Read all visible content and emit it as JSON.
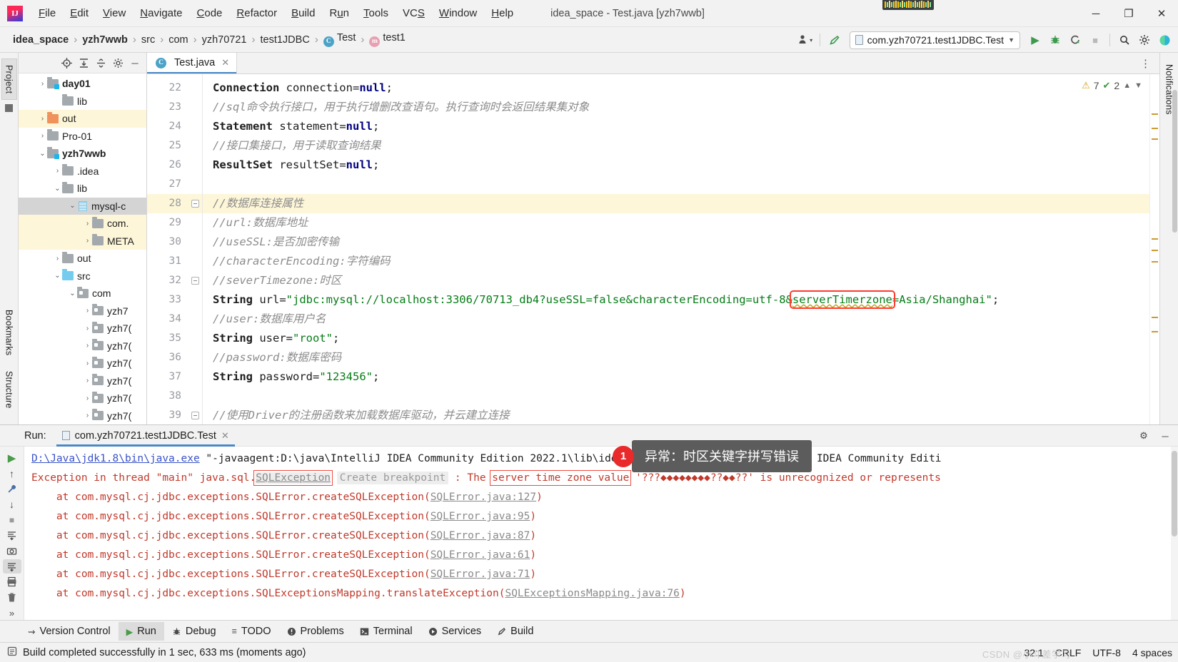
{
  "window": {
    "title": "idea_space - Test.java [yzh7wwb]",
    "logo_text": "IJ",
    "minimize": "─",
    "maximize": "❐",
    "close": "✕"
  },
  "menu": [
    {
      "label": "File",
      "mnemonic": "F"
    },
    {
      "label": "Edit",
      "mnemonic": "E"
    },
    {
      "label": "View",
      "mnemonic": "V"
    },
    {
      "label": "Navigate",
      "mnemonic": "N"
    },
    {
      "label": "Code",
      "mnemonic": "C"
    },
    {
      "label": "Refactor",
      "mnemonic": "R"
    },
    {
      "label": "Build",
      "mnemonic": "B"
    },
    {
      "label": "Run",
      "mnemonic": "u"
    },
    {
      "label": "Tools",
      "mnemonic": "T"
    },
    {
      "label": "VCS",
      "mnemonic": "S"
    },
    {
      "label": "Window",
      "mnemonic": "W"
    },
    {
      "label": "Help",
      "mnemonic": "H"
    }
  ],
  "breadcrumbs": [
    {
      "label": "idea_space",
      "bold": true,
      "icon": ""
    },
    {
      "label": "yzh7wwb",
      "bold": true,
      "icon": ""
    },
    {
      "label": "src",
      "bold": false,
      "icon": ""
    },
    {
      "label": "com",
      "bold": false,
      "icon": ""
    },
    {
      "label": "yzh70721",
      "bold": false,
      "icon": ""
    },
    {
      "label": "test1JDBC",
      "bold": false,
      "icon": ""
    },
    {
      "label": "Test",
      "bold": false,
      "icon": "class-icon",
      "icon_char": "C"
    },
    {
      "label": "test1",
      "bold": false,
      "icon": "method-icon",
      "icon_char": "m"
    }
  ],
  "toolbar": {
    "profiler_icon": "profiler-icon",
    "hammer_icon": "build-icon",
    "run_config": "com.yzh70721.test1JDBC.Test",
    "run_icon": "▶",
    "debug_icon": "debug-icon",
    "coverage_icon": "coverage-icon",
    "stop_icon": "■",
    "search_icon": "⌕",
    "settings_icon": "⚙",
    "ai_icon": "ai-assistant-icon"
  },
  "left_rail": {
    "project_tab": "Project",
    "bottom_tabs": [
      "Bookmarks",
      "Structure"
    ]
  },
  "right_rail": {
    "tabs": [
      "Notifications"
    ]
  },
  "project_panel": {
    "header_icons": [
      "locate-icon",
      "expand-all-icon",
      "collapse-all-icon",
      "gear-icon",
      "hide-icon"
    ],
    "tree": [
      {
        "indent": 1,
        "arrow": "›",
        "icon": "folder-module",
        "label": "day01",
        "bold": true,
        "state": "cut"
      },
      {
        "indent": 2,
        "arrow": "",
        "icon": "folder-grey",
        "label": "lib",
        "bold": false,
        "state": ""
      },
      {
        "indent": 1,
        "arrow": "›",
        "icon": "folder-orange",
        "label": "out",
        "bold": false,
        "state": "hl"
      },
      {
        "indent": 1,
        "arrow": "›",
        "icon": "folder-grey",
        "label": "Pro-01",
        "bold": false,
        "state": ""
      },
      {
        "indent": 1,
        "arrow": "⌄",
        "icon": "folder-module",
        "label": "yzh7wwb",
        "bold": true,
        "state": ""
      },
      {
        "indent": 2,
        "arrow": "›",
        "icon": "folder-grey",
        "label": ".idea",
        "bold": false,
        "state": ""
      },
      {
        "indent": 2,
        "arrow": "⌄",
        "icon": "folder-grey",
        "label": "lib",
        "bold": false,
        "state": ""
      },
      {
        "indent": 3,
        "arrow": "⌄",
        "icon": "jar",
        "label": "mysql-c",
        "bold": false,
        "state": "sel"
      },
      {
        "indent": 4,
        "arrow": "›",
        "icon": "folder-grey",
        "label": "com.",
        "bold": false,
        "state": "hl"
      },
      {
        "indent": 4,
        "arrow": "›",
        "icon": "folder-grey",
        "label": "META",
        "bold": false,
        "state": "hl"
      },
      {
        "indent": 2,
        "arrow": "›",
        "icon": "folder-grey",
        "label": "out",
        "bold": false,
        "state": ""
      },
      {
        "indent": 2,
        "arrow": "⌄",
        "icon": "folder-blue",
        "label": "src",
        "bold": false,
        "state": ""
      },
      {
        "indent": 3,
        "arrow": "⌄",
        "icon": "folder-pkg",
        "label": "com",
        "bold": false,
        "state": ""
      },
      {
        "indent": 4,
        "arrow": "›",
        "icon": "folder-pkg",
        "label": "yzh7",
        "bold": false,
        "state": ""
      },
      {
        "indent": 4,
        "arrow": "›",
        "icon": "folder-pkg",
        "label": "yzh7(",
        "bold": false,
        "state": ""
      },
      {
        "indent": 4,
        "arrow": "›",
        "icon": "folder-pkg",
        "label": "yzh7(",
        "bold": false,
        "state": ""
      },
      {
        "indent": 4,
        "arrow": "›",
        "icon": "folder-pkg",
        "label": "yzh7(",
        "bold": false,
        "state": ""
      },
      {
        "indent": 4,
        "arrow": "›",
        "icon": "folder-pkg",
        "label": "yzh7(",
        "bold": false,
        "state": ""
      },
      {
        "indent": 4,
        "arrow": "›",
        "icon": "folder-pkg",
        "label": "yzh7(",
        "bold": false,
        "state": ""
      },
      {
        "indent": 4,
        "arrow": "›",
        "icon": "folder-pkg",
        "label": "yzh7(",
        "bold": false,
        "state": ""
      }
    ]
  },
  "editor": {
    "tab": {
      "label": "Test.java",
      "icon_char": "C",
      "close": "✕"
    },
    "inspection": {
      "warn_count": "7",
      "ok_count": "2",
      "warn_icon": "⚠",
      "ok_icon": "✔",
      "up": "⌃",
      "down": "⌄"
    },
    "lines": [
      {
        "num": "22",
        "fold": false,
        "hl": false,
        "tokens": [
          {
            "t": "Connection ",
            "c": "type"
          },
          {
            "t": "connection=",
            "c": "plain"
          },
          {
            "t": "null",
            "c": "nullkw"
          },
          {
            "t": ";",
            "c": "plain"
          }
        ]
      },
      {
        "num": "23",
        "fold": false,
        "hl": false,
        "tokens": [
          {
            "t": "//sql命令执行接口，用于执行增删改查语句。执行查询时会返回结果集对象",
            "c": "cmt"
          }
        ]
      },
      {
        "num": "24",
        "fold": false,
        "hl": false,
        "tokens": [
          {
            "t": "Statement ",
            "c": "type"
          },
          {
            "t": "statement=",
            "c": "plain"
          },
          {
            "t": "null",
            "c": "nullkw"
          },
          {
            "t": ";",
            "c": "plain"
          }
        ]
      },
      {
        "num": "25",
        "fold": false,
        "hl": false,
        "tokens": [
          {
            "t": "//接口集接口，用于读取查询结果",
            "c": "cmt"
          }
        ]
      },
      {
        "num": "26",
        "fold": false,
        "hl": false,
        "tokens": [
          {
            "t": "ResultSet ",
            "c": "type"
          },
          {
            "t": "resultSet=",
            "c": "plain"
          },
          {
            "t": "null",
            "c": "nullkw"
          },
          {
            "t": ";",
            "c": "plain"
          }
        ]
      },
      {
        "num": "27",
        "fold": false,
        "hl": false,
        "tokens": []
      },
      {
        "num": "28",
        "fold": true,
        "hl": true,
        "tokens": [
          {
            "t": "//数据库连接属性",
            "c": "cmt"
          }
        ]
      },
      {
        "num": "29",
        "fold": false,
        "hl": false,
        "tokens": [
          {
            "t": "//url:数据库地址",
            "c": "cmt"
          }
        ]
      },
      {
        "num": "30",
        "fold": false,
        "hl": false,
        "tokens": [
          {
            "t": "//useSSL:是否加密传输",
            "c": "cmt"
          }
        ]
      },
      {
        "num": "31",
        "fold": false,
        "hl": false,
        "tokens": [
          {
            "t": "//characterEncoding:字符编码",
            "c": "cmt"
          }
        ]
      },
      {
        "num": "32",
        "fold": true,
        "hl": false,
        "tokens": [
          {
            "t": "//severTimezone:时区",
            "c": "cmt"
          }
        ]
      },
      {
        "num": "33",
        "fold": false,
        "hl": false,
        "tokens": [
          {
            "t": "String ",
            "c": "type"
          },
          {
            "t": "url=",
            "c": "plain"
          },
          {
            "t": "\"jdbc:mysql://localhost:3306/70713_db4?useSSL=false&characterEncoding=utf-8&",
            "c": "str"
          },
          {
            "t": "serverTimerzone",
            "c": "str typo-box squiggle"
          },
          {
            "t": "=Asia/Shanghai\"",
            "c": "str"
          },
          {
            "t": ";",
            "c": "plain"
          }
        ]
      },
      {
        "num": "34",
        "fold": false,
        "hl": false,
        "tokens": [
          {
            "t": "//user:数据库用户名",
            "c": "cmt"
          }
        ]
      },
      {
        "num": "35",
        "fold": false,
        "hl": false,
        "tokens": [
          {
            "t": "String ",
            "c": "type"
          },
          {
            "t": "user=",
            "c": "plain"
          },
          {
            "t": "\"root\"",
            "c": "str"
          },
          {
            "t": ";",
            "c": "plain"
          }
        ]
      },
      {
        "num": "36",
        "fold": false,
        "hl": false,
        "tokens": [
          {
            "t": "//password:数据库密码",
            "c": "cmt"
          }
        ]
      },
      {
        "num": "37",
        "fold": false,
        "hl": false,
        "tokens": [
          {
            "t": "String ",
            "c": "type"
          },
          {
            "t": "password=",
            "c": "plain"
          },
          {
            "t": "\"123456\"",
            "c": "str"
          },
          {
            "t": ";",
            "c": "plain"
          }
        ]
      },
      {
        "num": "38",
        "fold": false,
        "hl": false,
        "tokens": []
      },
      {
        "num": "39",
        "fold": true,
        "hl": false,
        "tokens": [
          {
            "t": "//使用Driver的注册函数来加载数据库驱动，并云建立连接",
            "c": "cmt"
          }
        ]
      }
    ]
  },
  "annotation": {
    "number": "1",
    "text": "异常：时区关键字拼写错误"
  },
  "run_panel": {
    "label": "Run:",
    "tab_title": "com.yzh70721.test1JDBC.Test",
    "tab_close": "✕",
    "gear_icon": "⚙",
    "hide_icon": "─",
    "side_icons": [
      "run-icon",
      "up-arrow-icon",
      "wrench-icon",
      "down-arrow-icon",
      "stop-icon",
      "soft-wrap-icon",
      "camera-icon",
      "scroll-to-end-icon",
      "print-icon",
      "trash-icon"
    ],
    "console": [
      {
        "segments": [
          {
            "t": "D:\\Java\\jdk1.8\\bin\\java.exe",
            "c": "lnk"
          },
          {
            "t": " \"-javaagent:D:\\java\\IntelliJ IDEA Community Edition 2022.1\\lib\\idea_rt.jar=64885:D:\\java\\IntelliJ IDEA Community Editi",
            "c": "arg"
          }
        ]
      },
      {
        "segments": [
          {
            "t": "Exception in thread \"main\" java.sql.",
            "c": ""
          },
          {
            "t": "SQLException",
            "c": "sqlex redbox"
          },
          {
            "t": " ",
            "c": ""
          },
          {
            "t": "Create breakpoint",
            "c": "bp"
          },
          {
            "t": " : The ",
            "c": ""
          },
          {
            "t": "server time zone value",
            "c": "redbox"
          },
          {
            "t": " '???◆◆◆◆◆◆◆◆??◆◆??' is unrecognized or represents",
            "c": ""
          }
        ]
      },
      {
        "segments": [
          {
            "t": "    at com.mysql.cj.jdbc.exceptions.SQLError.createSQLException(",
            "c": ""
          },
          {
            "t": "SQLError.java:127",
            "c": "grey-lnk"
          },
          {
            "t": ")",
            "c": ""
          }
        ]
      },
      {
        "segments": [
          {
            "t": "    at com.mysql.cj.jdbc.exceptions.SQLError.createSQLException(",
            "c": ""
          },
          {
            "t": "SQLError.java:95",
            "c": "grey-lnk"
          },
          {
            "t": ")",
            "c": ""
          }
        ]
      },
      {
        "segments": [
          {
            "t": "    at com.mysql.cj.jdbc.exceptions.SQLError.createSQLException(",
            "c": ""
          },
          {
            "t": "SQLError.java:87",
            "c": "grey-lnk"
          },
          {
            "t": ")",
            "c": ""
          }
        ]
      },
      {
        "segments": [
          {
            "t": "    at com.mysql.cj.jdbc.exceptions.SQLError.createSQLException(",
            "c": ""
          },
          {
            "t": "SQLError.java:61",
            "c": "grey-lnk"
          },
          {
            "t": ")",
            "c": ""
          }
        ]
      },
      {
        "segments": [
          {
            "t": "    at com.mysql.cj.jdbc.exceptions.SQLError.createSQLException(",
            "c": ""
          },
          {
            "t": "SQLError.java:71",
            "c": "grey-lnk"
          },
          {
            "t": ")",
            "c": ""
          }
        ]
      },
      {
        "segments": [
          {
            "t": "    at com.mysql.cj.jdbc.exceptions.SQLExceptionsMapping.translateException(",
            "c": ""
          },
          {
            "t": "SQLExceptionsMapping.java:76",
            "c": "grey-lnk"
          },
          {
            "t": ")",
            "c": ""
          }
        ]
      }
    ]
  },
  "bottom_bar": [
    {
      "label": "Version Control",
      "icon": "⑂",
      "active": false
    },
    {
      "label": "Run",
      "icon": "▶",
      "active": true
    },
    {
      "label": "Debug",
      "icon": "debug-icon",
      "active": false
    },
    {
      "label": "TODO",
      "icon": "≡",
      "active": false
    },
    {
      "label": "Problems",
      "icon": "❗",
      "active": false
    },
    {
      "label": "Terminal",
      "icon": "⌨",
      "active": false
    },
    {
      "label": "Services",
      "icon": "▷",
      "active": false
    },
    {
      "label": "Build",
      "icon": "⚒",
      "active": false
    }
  ],
  "status_bar": {
    "icon": "event-log-icon",
    "message": "Build completed successfully in 1 sec, 633 ms (moments ago)",
    "caret": "32:1",
    "line_sep": "CRLF",
    "encoding": "UTF-8",
    "indent": "4 spaces",
    "watermark": "CSDN @小斗差学习"
  }
}
